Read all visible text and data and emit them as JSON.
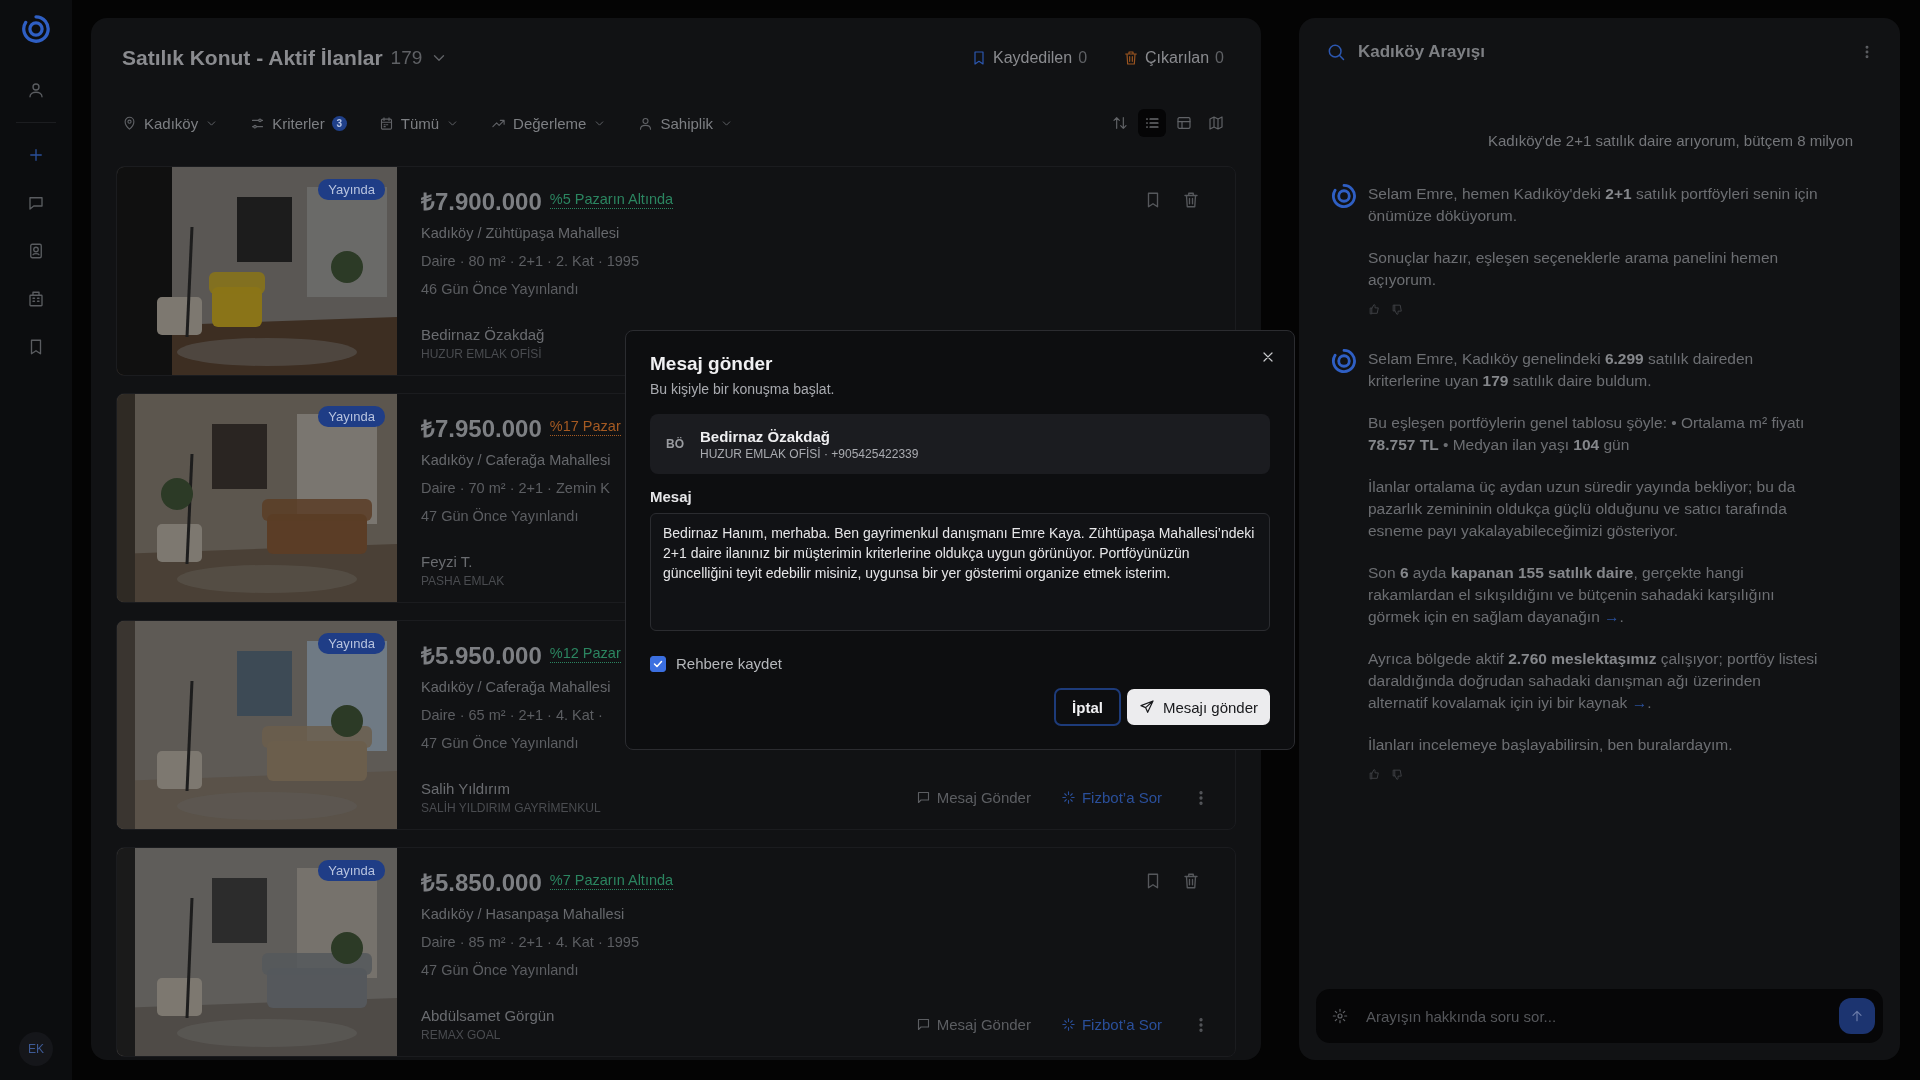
{
  "rail": {
    "items": [
      {
        "kind": "profile"
      },
      {
        "kind": "new"
      },
      {
        "kind": "chat"
      },
      {
        "kind": "contacts"
      },
      {
        "kind": "buildings"
      },
      {
        "kind": "saved"
      }
    ],
    "avatar": "EK"
  },
  "header": {
    "title": "Satılık Konut - Aktif İlanlar",
    "count": "179",
    "saved": {
      "label": "Kaydedilen",
      "count": "0"
    },
    "removed": {
      "label": "Çıkarılan",
      "count": "0"
    }
  },
  "filters": [
    {
      "kind": "location",
      "label": "Kadıköy"
    },
    {
      "kind": "criteria",
      "label": "Kriterler",
      "badge": "3"
    },
    {
      "kind": "date",
      "label": "Tümü"
    },
    {
      "kind": "valuation",
      "label": "Değerleme"
    },
    {
      "kind": "ownership",
      "label": "Sahiplik"
    }
  ],
  "views": [
    {
      "kind": "list",
      "selected": true
    },
    {
      "kind": "table",
      "selected": false
    },
    {
      "kind": "map",
      "selected": false
    }
  ],
  "listings": [
    {
      "status": "Yayında",
      "price": "₺7.900.000",
      "market": {
        "text": "%5 Pazarın Altında",
        "color": "#2b8560"
      },
      "location": "Kadıköy / Zühtüpaşa Mahallesi",
      "meta": "Daire · 80 m² · 2+1 · 2. Kat · 1995",
      "posted": "46 Gün Önce Yayınlandı",
      "agent": "Bedirnaz Özakdağ",
      "agency": "HUZUR EMLAK OFİSİ",
      "top_icons": true
    },
    {
      "status": "Yayında",
      "price": "₺7.950.000",
      "market": {
        "text": "%17 Pazar",
        "color": "#a55a22"
      },
      "location": "Kadıköy / Caferağa Mahallesi",
      "meta": "Daire · 70 m² · 2+1 · Zemin K",
      "posted": "47 Gün Önce Yayınlandı",
      "agent": "Feyzi T.",
      "agency": "PASHA EMLAK"
    },
    {
      "status": "Yayında",
      "price": "₺5.950.000",
      "market": {
        "text": "%12 Pazar",
        "color": "#2b8560"
      },
      "location": "Kadıköy / Caferağa Mahallesi",
      "meta": "Daire · 65 m² · 2+1 · 4. Kat ·",
      "posted": "47 Gün Önce Yayınlandı",
      "agent": "Salih Yıldırım",
      "agency": "SALİH YILDIRIM GAYRİMENKUL",
      "actions": [
        {
          "kind": "message",
          "label": "Mesaj Gönder"
        },
        {
          "kind": "ask",
          "label": "Fizbot’a Sor"
        },
        {
          "kind": "more"
        }
      ]
    },
    {
      "status": "Yayında",
      "price": "₺5.850.000",
      "market": {
        "text": "%7 Pazarın Altında",
        "color": "#2b8560"
      },
      "location": "Kadıköy / Hasanpaşa Mahallesi",
      "meta": "Daire · 85 m² · 2+1 · 4. Kat · 1995",
      "posted": "47 Gün Önce Yayınlandı",
      "agent": "Abdülsamet Görgün",
      "agency": "REMAX GOAL",
      "top_icons": true,
      "actions": [
        {
          "kind": "message",
          "label": "Mesaj Gönder"
        },
        {
          "kind": "ask",
          "label": "Fizbot’a Sor"
        },
        {
          "kind": "more"
        }
      ]
    }
  ],
  "chat": {
    "title": "Kadıköy Arayışı",
    "messages": [
      {
        "kind": "user",
        "text": "Kadıköy'de 2+1 satılık daire arıyorum, bütçem 8 milyon"
      },
      {
        "kind": "bot",
        "paragraphs": [
          {
            "text": "Selam Emre, hemen Kadıköy'deki **2+1** satılık portföyleri senin için önümüze döküyorum."
          },
          {
            "text": "Sonuçlar hazır, eşleşen seçeneklerle arama panelini hemen açıyorum."
          }
        ]
      },
      {
        "kind": "bot",
        "paragraphs": [
          {
            "text": "Selam Emre, Kadıköy genelindeki **6.299** satılık daireden kriterlerine uyan **179** satılık daire buldum."
          },
          {
            "text": "Bu eşleşen portföylerin genel tablosu şöyle: • Ortalama m² fiyatı **78.757 TL** • Medyan ilan yaşı **104** gün"
          },
          {
            "text": "İlanlar ortalama üç aydan uzun süredir yayında bekliyor; bu da pazarlık zemininin oldukça güçlü olduğunu ve satıcı tarafında esneme payı yakalayabileceğimizi gösteriyor."
          },
          {
            "text": "Son **6** ayda **kapanan 155 satılık daire**, gerçekte hangi rakamlardan el sıkışıldığını ve bütçenin sahadaki karşılığını görmek için en sağlam dayanağın",
            "link": "→",
            "end": "."
          },
          {
            "text": "Ayrıca bölgede aktif **2.760 meslektaşımız** çalışıyor; portföy listesi daraldığında doğrudan sahadaki danışman ağı üzerinden alternatif kovalamak için iyi bir kaynak",
            "link": "→",
            "end": "."
          },
          {
            "text": "İlanları incelemeye başlayabilirsin, ben buralardayım."
          }
        ]
      }
    ],
    "input": {
      "placeholder": "Arayışın hakkında soru sor..."
    }
  },
  "modal": {
    "title": "Mesaj gönder",
    "subtitle": "Bu kişiyle bir konuşma başlat.",
    "contact": {
      "initials": "BÖ",
      "name": "Bedirnaz Özakdağ",
      "details": "HUZUR EMLAK OFİSİ · +905425422339"
    },
    "message_label": "Mesaj",
    "message": "Bedirnaz Hanım, merhaba. Ben gayrimenkul danışmanı Emre Kaya. Zühtüpaşa Mahallesi’ndeki 2+1 daire ilanınız bir müşterimin kriterlerine oldukça uygun görünüyor. Portföyünüzün güncelliğini teyit edebilir misiniz, uygunsa bir yer gösterimi organize etmek isterim.",
    "save_contact": {
      "label": "Rehbere kaydet",
      "checked": true
    },
    "cancel": "İptal",
    "send": "Mesajı gönder"
  }
}
